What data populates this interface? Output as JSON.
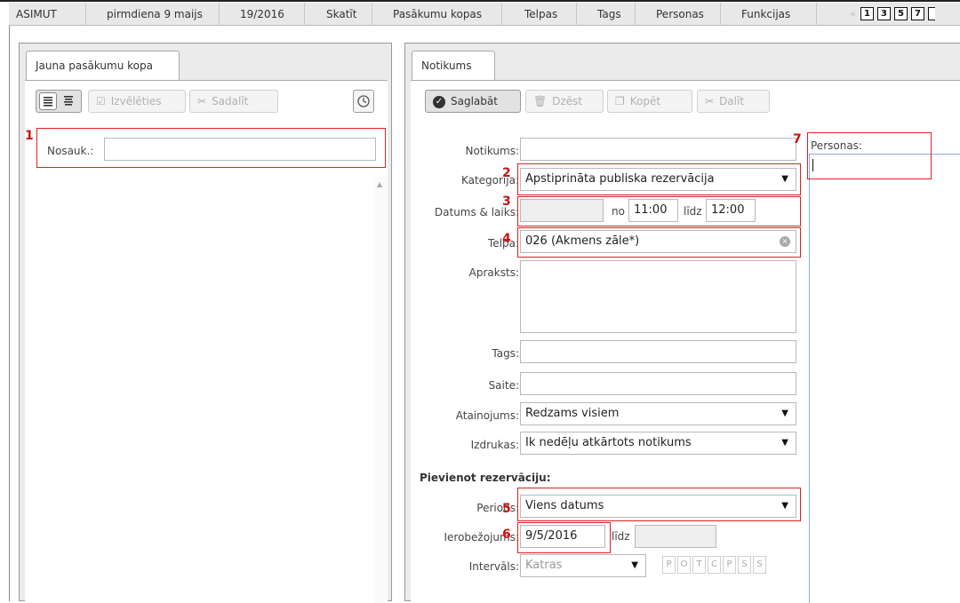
{
  "menu": {
    "items": [
      "ASIMUT",
      "pirmdiena 9 maijs",
      "19/2016",
      "Skatīt",
      "Pasākumu kopas",
      "Telpas",
      "Tags",
      "Personas",
      "Funkcijas"
    ],
    "page_buttons": [
      "1",
      "3",
      "5",
      "7"
    ]
  },
  "left_panel": {
    "tab": "Jauna pasākumu kopa",
    "toolbar": {
      "select": "Izvēlēties",
      "split": "Sadalīt"
    },
    "name_label": "Nosauk.:",
    "name_value": ""
  },
  "right_panel": {
    "tab": "Notikums",
    "toolbar": {
      "save": "Saglabāt",
      "delete": "Dzēst",
      "copy": "Kopēt",
      "split": "Dalīt"
    },
    "form": {
      "event_label": "Notikums:",
      "event_value": "",
      "category_label": "Kategorija:",
      "category_value": "Apstiprināta publiska rezervācija",
      "datetime_label": "Datums & laiks:",
      "date_value": "",
      "from_label": "no",
      "from_value": "11:00",
      "to_label": "līdz",
      "to_value": "12:00",
      "room_label": "Telpa:",
      "room_value": "026 (Akmens zāle*)",
      "description_label": "Apraksts:",
      "tags_label": "Tags:",
      "link_label": "Saite:",
      "display_label": "Atainojums:",
      "display_value": "Redzams visiem",
      "print_label": "Izdrukas:",
      "print_value": "Ik nedēļu atkārtots notikums",
      "add_booking_heading": "Pievienot rezervāciju:",
      "period_label": "Periods:",
      "period_value": "Viens datums",
      "limit_label": "Ierobežojums:",
      "limit_value": "9/5/2016",
      "limit_to_label": "līdz",
      "limit_to_value": "",
      "interval_label": "Intervāls:",
      "interval_value": "Katras",
      "days": [
        "P",
        "O",
        "T",
        "C",
        "P",
        "S",
        "S"
      ]
    },
    "persons_label": "Personas:"
  },
  "annotations": [
    "1",
    "2",
    "3",
    "4",
    "5",
    "6",
    "7"
  ],
  "colors": {
    "annotation": "#e02020",
    "focus_border": "#8aa8e8"
  }
}
